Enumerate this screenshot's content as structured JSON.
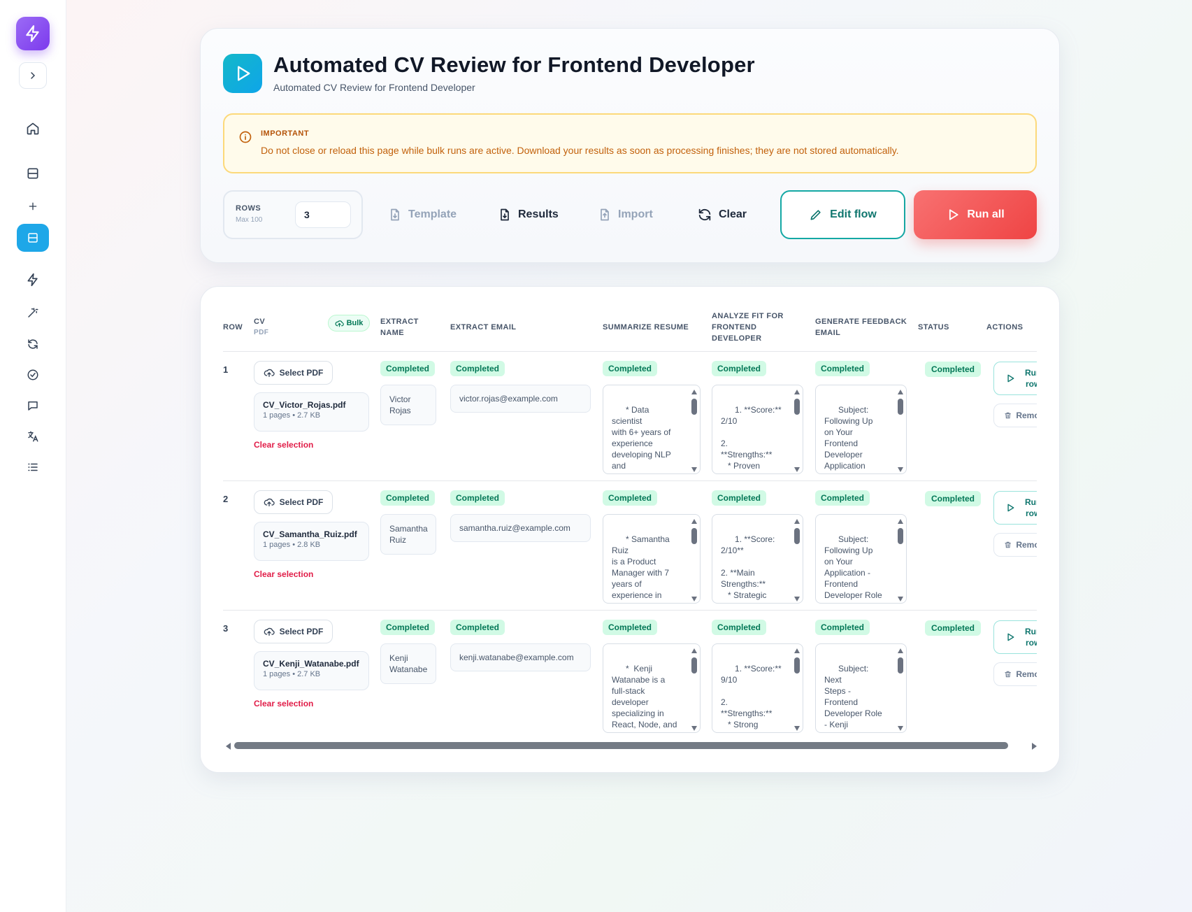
{
  "header": {
    "title": "Automated CV Review for Frontend Developer",
    "subtitle": "Automated CV Review for Frontend Developer"
  },
  "alert": {
    "title": "IMPORTANT",
    "message": "Do not close or reload this page while bulk runs are active. Download your results as soon as processing finishes; they are not stored automatically."
  },
  "toolbar": {
    "rows_label": "ROWS",
    "rows_max": "Max 100",
    "rows_value": "3",
    "template": "Template",
    "results": "Results",
    "import": "Import",
    "clear": "Clear",
    "edit_flow": "Edit flow",
    "run_all": "Run all"
  },
  "columns": {
    "row": "ROW",
    "cv": "CV",
    "cv_sub": "PDF",
    "bulk": "Bulk",
    "extract_name": [
      "EXTRACT",
      "NAME"
    ],
    "extract_email": "EXTRACT EMAIL",
    "summarize": "SUMMARIZE RESUME",
    "analyze": [
      "ANALYZE FIT FOR",
      "FRONTEND",
      "DEVELOPER"
    ],
    "feedback": [
      "GENERATE FEEDBACK",
      "EMAIL"
    ],
    "status": "STATUS",
    "actions": "ACTIONS"
  },
  "labels": {
    "select_pdf": "Select PDF",
    "clear_selection": "Clear selection",
    "completed": "Completed",
    "run_row": [
      "Run",
      "row"
    ],
    "remove": "Remove"
  },
  "rows": [
    {
      "num": "1",
      "file_name": "CV_Victor_Rojas.pdf",
      "file_meta": "1 pages • 2.7 KB",
      "name": "Victor\nRojas",
      "email": "victor.rojas@example.com",
      "summary": "* Data scientist\nwith 6+ years of\nexperience\ndeveloping NLP\nand\nrecommendation\nsystems,",
      "analysis": "1. **Score:**\n2/10\n\n2.\n**Strengths:**\n   * Proven\nexperience",
      "feedback": "Subject:\nFollowing Up\non Your\nFrontend\nDeveloper\nApplication",
      "status": "Completed"
    },
    {
      "num": "2",
      "file_name": "CV_Samantha_Ruiz.pdf",
      "file_meta": "1 pages • 2.8 KB",
      "name": "Samantha\nRuiz",
      "email": "samantha.ruiz@example.com",
      "summary": "* Samantha Ruiz\nis a Product\nManager with 7\nyears of\nexperience in\nSaaS,\nspecializing in",
      "analysis": "1. **Score:\n2/10**\n\n2. **Main\nStrengths:**\n   * Strategic\nThinking:",
      "feedback": "Subject:\nFollowing Up\non Your\nApplication -\nFrontend\nDeveloper Role\nat [Company",
      "status": "Completed"
    },
    {
      "num": "3",
      "file_name": "CV_Kenji_Watanabe.pdf",
      "file_meta": "1 pages • 2.7 KB",
      "name": "Kenji\nWatanabe",
      "email": "kenji.watanabe@example.com",
      "summary": "*  Kenji\nWatanabe is a\nfull-stack\ndeveloper\nspecializing in\nReact, Node, and\nPrisma, with",
      "analysis": "1. **Score:**\n9/10\n\n2.\n**Strengths:**\n   * Strong\nReact and",
      "feedback": "Subject: Next\nSteps -\nFrontend\nDeveloper Role\n- Kenji\nWatanabe",
      "status": "Completed"
    }
  ]
}
